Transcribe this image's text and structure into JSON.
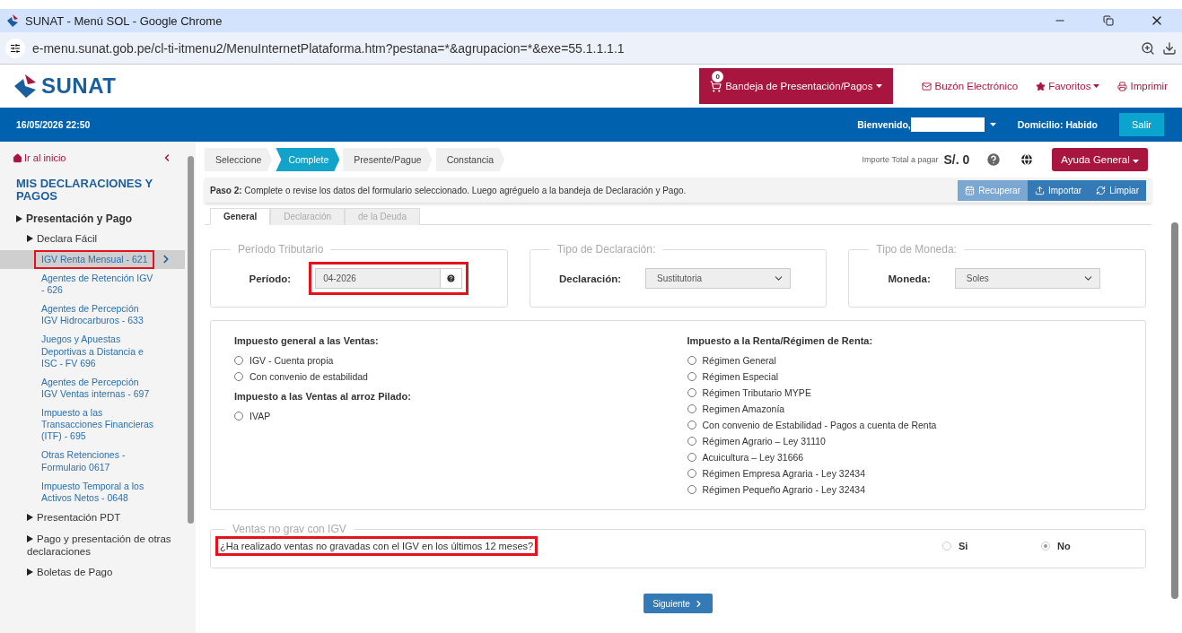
{
  "browser": {
    "title": "SUNAT - Menú SOL - Google Chrome",
    "url": "e-menu.sunat.gob.pe/cl-ti-itmenu2/MenuInternetPlataforma.htm?pestana=*&agrupacion=*&exe=55.1.1.1.1"
  },
  "header": {
    "logo": "SUNAT",
    "cart_count": "0",
    "tray": "Bandeja de Presentación/Pagos",
    "links": [
      {
        "label": "Buzón Electrónico",
        "kind": "mail",
        "dropdown": false
      },
      {
        "label": "Favoritos",
        "kind": "star",
        "dropdown": true
      },
      {
        "label": "Imprimir",
        "kind": "print",
        "dropdown": false
      }
    ]
  },
  "topbar": {
    "datetime": "16/05/2026 22:50",
    "welcome": "Bienvenido,",
    "domicilio": "Domicilio: Habido",
    "logout": "Salir"
  },
  "sidebar": {
    "home": "Ir al inicio",
    "heading": "MIS DECLARACIONES Y PAGOS",
    "items": [
      {
        "label": "Presentación y Pago",
        "children": [
          {
            "label": "Declara Fácil",
            "children": [
              {
                "label": "IGV Renta Mensual - 621",
                "selected": true,
                "highlighted": true
              },
              {
                "label": "Agentes de Retención IGV - 626",
                "selected": false,
                "highlighted": false
              },
              {
                "label": "Agentes de Percepción IGV Hidrocarburos - 633",
                "selected": false,
                "highlighted": false
              },
              {
                "label": "Juegos y Apuestas Deportivas a Distancia e ISC - FV 696",
                "selected": false,
                "highlighted": false
              },
              {
                "label": "Agentes de Percepción IGV Ventas internas - 697",
                "selected": false,
                "highlighted": false
              },
              {
                "label": "Impuesto a las Transacciones Financieras (ITF) - 695",
                "selected": false,
                "highlighted": false
              },
              {
                "label": "Otras Retenciones - Formulario 0617",
                "selected": false,
                "highlighted": false
              },
              {
                "label": "Impuesto Temporal a los Activos Netos - 0648",
                "selected": false,
                "highlighted": false
              }
            ]
          },
          {
            "label": "Presentación PDT"
          },
          {
            "label": "Pago y presentación de otras declaraciones"
          },
          {
            "label": "Boletas de Pago"
          }
        ]
      }
    ]
  },
  "steps": [
    {
      "label": "Seleccione",
      "selected": false
    },
    {
      "label": "Complete",
      "selected": true
    },
    {
      "label": "Presente/Pague",
      "selected": false
    },
    {
      "label": "Constancia",
      "selected": false
    }
  ],
  "total": {
    "label": "Importe Total a pagar",
    "amount": "S/. 0"
  },
  "help_button": "Ayuda General",
  "step_hint": "**Paso 2:** Complete o revise los datos del formulario seleccionado. Luego agréguelo a la bandeja de Declaración y Pago.",
  "actions": [
    {
      "label": "Recuperar",
      "kind": "calendar",
      "disabled": true
    },
    {
      "label": "Importar",
      "kind": "upload",
      "disabled": false
    },
    {
      "label": "Limpiar",
      "kind": "refresh",
      "disabled": false
    }
  ],
  "form_tabs": [
    {
      "label": "General",
      "selected": true
    },
    {
      "label": "Declaración",
      "selected": false
    },
    {
      "label": "de la Deuda",
      "selected": false
    }
  ],
  "fieldsets": [
    {
      "kind": "input",
      "legend": "Período Tributario",
      "label": "Período:",
      "value": "04-2026",
      "highlighted": true
    },
    {
      "kind": "select",
      "legend": "Tipo de Declaración:",
      "label": "Declaración:",
      "value": "Sustitutoria",
      "highlighted": false
    },
    {
      "kind": "select",
      "legend": "Tipo de Moneda:",
      "label": "Moneda:",
      "value": "Soles",
      "highlighted": false
    }
  ],
  "tax_columns": [
    [
      {
        "title": "Impuesto general a las Ventas:",
        "options": [
          {
            "label": "IGV - Cuenta propia",
            "selected": false
          },
          {
            "label": "Con convenio de estabilidad",
            "selected": false
          }
        ]
      },
      {
        "title": "Impuesto a las Ventas al arroz Pilado:",
        "options": [
          {
            "label": "IVAP",
            "selected": false
          }
        ]
      }
    ],
    [
      {
        "title": "Impuesto a la Renta/Régimen de Renta:",
        "options": [
          {
            "label": "Régimen General",
            "selected": false
          },
          {
            "label": "Régimen Especial",
            "selected": false
          },
          {
            "label": "Régimen Tributario MYPE",
            "selected": false
          },
          {
            "label": "Regimen Amazonía",
            "selected": false
          },
          {
            "label": "Con convenio de Estabilidad - Pagos a cuenta de Renta",
            "selected": false
          },
          {
            "label": "Régimen Agrario – Ley 31110",
            "selected": false
          },
          {
            "label": "Acuicultura – Ley 31666",
            "selected": false
          },
          {
            "label": "Régimen Empresa Agraria - Ley 32434",
            "selected": false
          },
          {
            "label": "Régimen Pequeño Agrario - Ley 32434",
            "selected": false
          }
        ]
      }
    ]
  ],
  "ventas": {
    "legend": "Ventas no grav con IGV",
    "question": "¿Ha realizado ventas no gravadas con el IGV en los últimos 12 meses?",
    "highlighted": true,
    "options": [
      {
        "label": "Si",
        "selected": false
      },
      {
        "label": "No",
        "selected": true
      }
    ]
  },
  "next_button": "Siguiente"
}
